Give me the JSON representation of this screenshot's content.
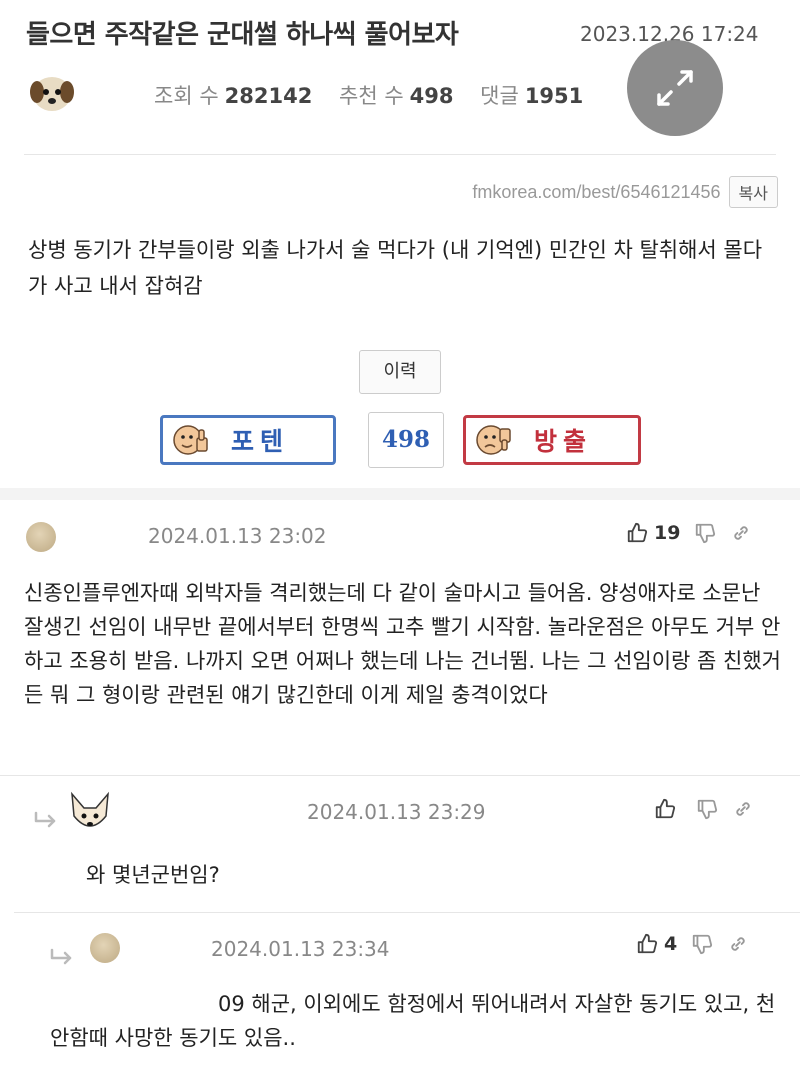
{
  "post": {
    "title": "들으면 주작같은 군대썰 하나씩 풀어보자",
    "date": "2023.12.26 17:24",
    "stats": {
      "views_label": "조회 수",
      "views": "282142",
      "recommend_label": "추천 수",
      "recommend": "498",
      "comments_label": "댓글",
      "comments": "1951"
    },
    "url": "fmkorea.com/best/6546121456",
    "copy_label": "복사",
    "body": "상병 동기가 간부들이랑 외출 나가서 술 먹다가 (내 기억엔) 민간인 차 탈취해서 몰다가 사고 내서 잡혀감",
    "history_label": "이력",
    "vote_up_label": "포텐",
    "vote_count": "498",
    "vote_down_label": "방출"
  },
  "comments": [
    {
      "date": "2024.01.13 23:02",
      "upvotes": "19",
      "text": "신종인플루엔자때 외박자들 격리했는데 다 같이 술마시고 들어옴. 양성애자로 소문난 잘생긴 선임이 내무반 끝에서부터 한명씩 고추 빨기 시작함. 놀라운점은 아무도 거부 안하고 조용히 받음. 나까지 오면 어쩌나 했는데 나는 건너뜀. 나는 그 선임이랑 좀 친했거든 뭐 그 형이랑 관련된 얘기 많긴한데 이게 제일 충격이었다"
    },
    {
      "date": "2024.01.13 23:29",
      "upvotes": "",
      "text": "와 몇년군번임?"
    },
    {
      "date": "2024.01.13 23:34",
      "upvotes": "4",
      "text": "09 해군, 이외에도 함정에서 뛰어내려서 자살한 동기도 있고, 천안함때 사망한 동기도 있음.."
    }
  ],
  "icons": {
    "expand": "expand-arrows-icon",
    "thumb_up": "thumbs-up-icon",
    "thumb_down": "thumbs-down-icon",
    "link": "link-icon",
    "reply": "reply-arrow-icon"
  },
  "colors": {
    "vote_up": "#2f5fb3",
    "vote_down": "#c2303c",
    "expand_overlay": "#8c8c8c"
  }
}
